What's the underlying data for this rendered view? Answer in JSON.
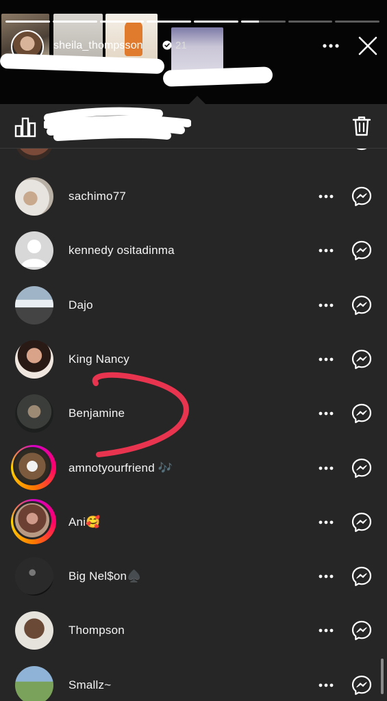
{
  "story": {
    "username": "sheila_thompsson",
    "time": "21",
    "progress": [
      1,
      1,
      1,
      1,
      1,
      0.4,
      0,
      0
    ],
    "icons": {
      "verified": "verified-badge-icon",
      "more": "more-horizontal-icon",
      "close": "close-x-icon"
    }
  },
  "toolbar": {
    "icons": {
      "insights": "bar-chart-icon",
      "delete": "trash-icon"
    }
  },
  "viewers": [
    {
      "name": "sachimo77",
      "story_ring": false
    },
    {
      "name": "kennedy ositadinma",
      "story_ring": false
    },
    {
      "name": "Dajo",
      "story_ring": false
    },
    {
      "name": "King Nancy",
      "story_ring": false
    },
    {
      "name": "Benjamine",
      "story_ring": false
    },
    {
      "name": "amnotyourfriend 🎶",
      "story_ring": true
    },
    {
      "name": "Ani🥰",
      "story_ring": true
    },
    {
      "name": "Big Nel$on♠️",
      "story_ring": false
    },
    {
      "name": "Thompson",
      "story_ring": false
    },
    {
      "name": "Smallz~",
      "story_ring": false
    }
  ],
  "row_icons": {
    "more": "more-horizontal-icon",
    "message": "messenger-icon"
  },
  "colors": {
    "sheet_background": "#262626",
    "header_background": "#050505",
    "annotation": "#e8344e",
    "story_ring": [
      "#d300c5",
      "#ff0069",
      "#ff7a00",
      "#ffd600"
    ]
  }
}
